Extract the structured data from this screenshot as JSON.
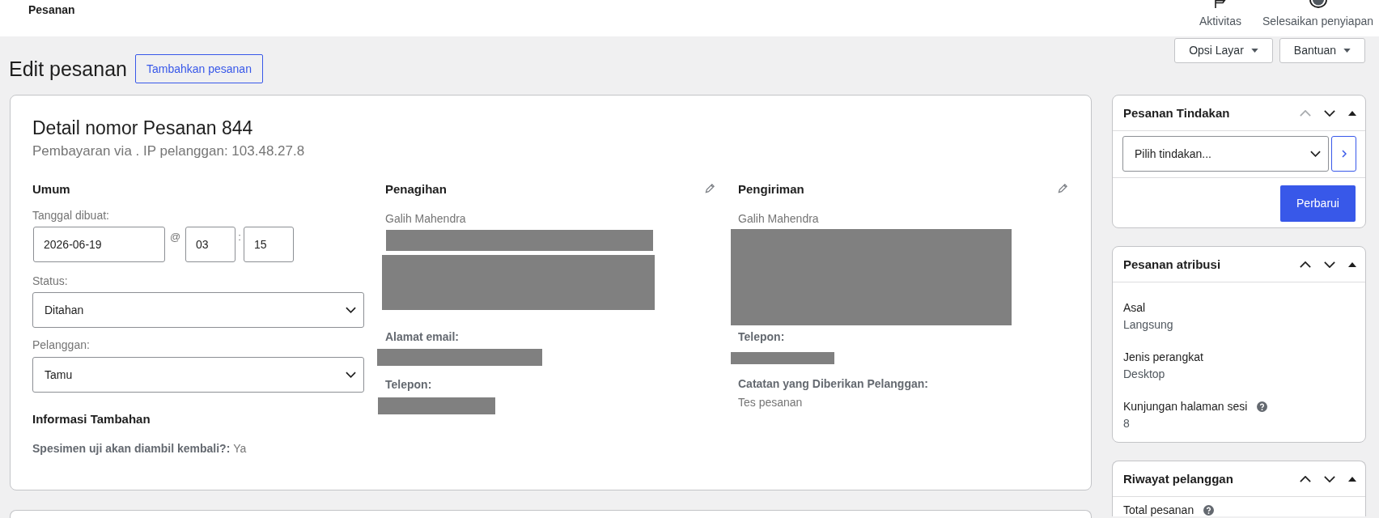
{
  "top_bar": {
    "title": "Pesanan",
    "actions": [
      {
        "label": "Aktivitas"
      },
      {
        "label": "Selesaikan penyiapan"
      }
    ]
  },
  "screen_tabs": [
    {
      "label": "Opsi Layar"
    },
    {
      "label": "Bantuan"
    }
  ],
  "page_header": {
    "title": "Edit pesanan",
    "add_button": "Tambahkan pesanan"
  },
  "order": {
    "title": "Detail nomor Pesanan 844",
    "subtitle": "Pembayaran via . IP pelanggan: 103.48.27.8",
    "general": {
      "heading": "Umum",
      "date_label": "Tanggal dibuat:",
      "date": "2026-06-19",
      "at_sign": "@",
      "hour": "03",
      "time_separator": ":",
      "minute": "15",
      "status_label": "Status:",
      "status": "Ditahan",
      "customer_label": "Pelanggan:",
      "customer": "Tamu",
      "extra_heading": "Informasi Tambahan",
      "extra_fields": [
        {
          "label": "Spesimen uji akan diambil kembali?:",
          "value": "Ya"
        }
      ]
    },
    "addresses": [
      {
        "heading": "Penagihan",
        "name": "Galih Mahendra",
        "address_redacted": true,
        "fields": [
          {
            "label": "Alamat email:",
            "redacted": true
          },
          {
            "label": "Telepon:",
            "redacted": true
          }
        ]
      },
      {
        "heading": "Pengiriman",
        "name": "Galih Mahendra",
        "address_redacted": true,
        "fields": [
          {
            "label": "Telepon:",
            "redacted": true
          },
          {
            "label": "Catatan yang Diberikan Pelanggan:",
            "redacted": false,
            "value": "Tes pesanan"
          }
        ]
      }
    ]
  },
  "panels": [
    {
      "kind": "actions",
      "title": "Pesanan Tindakan",
      "up_disabled": true,
      "expanded": true,
      "select": "Pilih tindakan...",
      "button": "Perbarui"
    },
    {
      "kind": "list",
      "title": "Pesanan atribusi",
      "up_disabled": false,
      "expanded": true,
      "items": [
        {
          "label": "Asal",
          "help": false,
          "value": "Langsung"
        },
        {
          "label": "Jenis perangkat",
          "help": false,
          "value": "Desktop"
        },
        {
          "label": "Kunjungan halaman sesi",
          "help": true,
          "value": "8"
        }
      ]
    },
    {
      "kind": "list",
      "title": "Riwayat pelanggan",
      "up_disabled": false,
      "expanded": true,
      "items": [
        {
          "label": "Total pesanan",
          "help": true
        }
      ]
    }
  ]
}
